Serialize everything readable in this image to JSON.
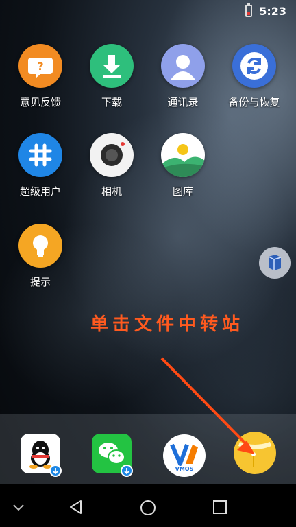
{
  "status_bar": {
    "time": "5:23"
  },
  "apps": [
    {
      "label": "意见反馈",
      "icon": "feedback-question-icon"
    },
    {
      "label": "下载",
      "icon": "download-icon"
    },
    {
      "label": "通讯录",
      "icon": "contacts-person-icon"
    },
    {
      "label": "备份与恢复",
      "icon": "backup-restore-icon"
    },
    {
      "label": "超级用户",
      "icon": "superuser-hash-icon"
    },
    {
      "label": "相机",
      "icon": "camera-icon"
    },
    {
      "label": "图库",
      "icon": "gallery-icon"
    },
    {
      "label": "提示",
      "icon": "lightbulb-icon"
    }
  ],
  "annotation": {
    "text": "单击文件中转站"
  },
  "dock": [
    {
      "icon": "qq-icon"
    },
    {
      "icon": "wechat-icon"
    },
    {
      "icon": "vmos-icon",
      "text": "VMOS"
    },
    {
      "icon": "file-transfer-station-icon"
    }
  ],
  "nav_bar": {
    "icons": [
      "collapse-chevron-icon",
      "back-icon",
      "home-icon",
      "recents-icon"
    ]
  },
  "colors": {
    "annotation": "#ff5a1f",
    "arrow": "#ff4a14"
  }
}
